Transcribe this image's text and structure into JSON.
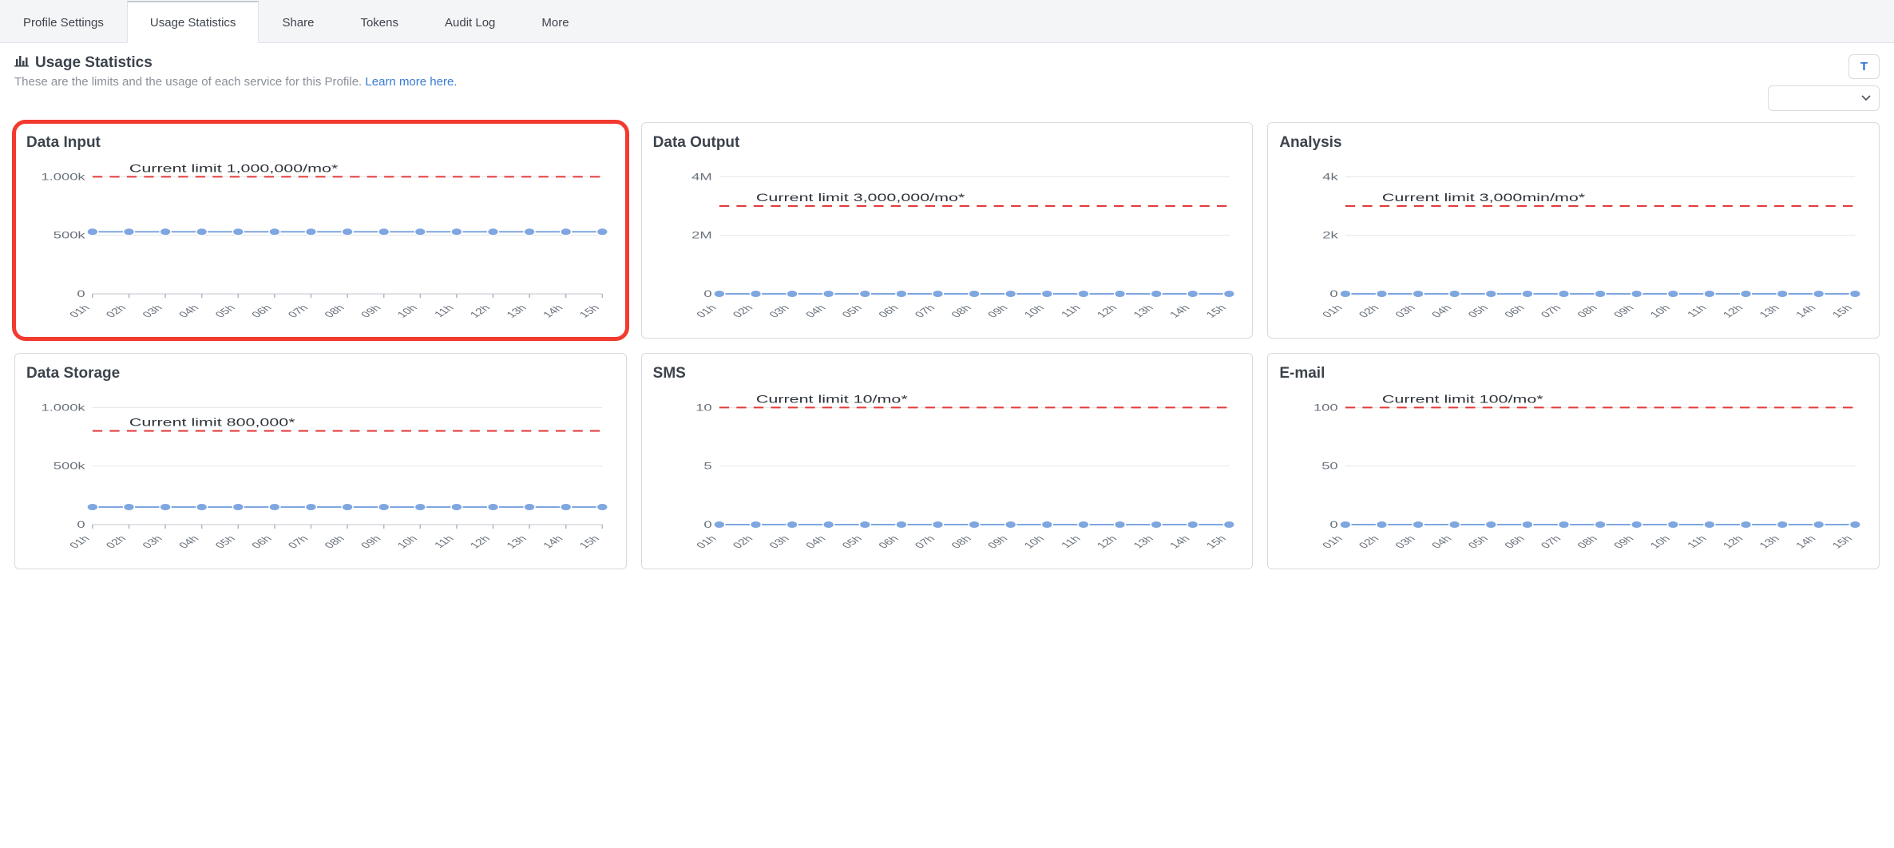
{
  "tabs": [
    {
      "label": "Profile Settings",
      "active": false
    },
    {
      "label": "Usage Statistics",
      "active": true
    },
    {
      "label": "Share",
      "active": false
    },
    {
      "label": "Tokens",
      "active": false
    },
    {
      "label": "Audit Log",
      "active": false
    },
    {
      "label": "More",
      "active": false
    }
  ],
  "header": {
    "title": "Usage Statistics",
    "subtitle": "These are the limits and the usage of each service for this Profile.",
    "learn_more": "Learn more here.",
    "badge_letter": "T"
  },
  "chart_data": [
    {
      "key": "data_input",
      "title": "Data Input",
      "type": "line",
      "highlighted": true,
      "categories": [
        "01h",
        "02h",
        "03h",
        "04h",
        "05h",
        "06h",
        "07h",
        "08h",
        "09h",
        "10h",
        "11h",
        "12h",
        "13h",
        "14h",
        "15h"
      ],
      "values": [
        530000,
        530000,
        530000,
        530000,
        530000,
        530000,
        530000,
        530000,
        530000,
        530000,
        530000,
        530000,
        530000,
        530000,
        530000
      ],
      "y_ticks": [
        0,
        500000,
        1000000
      ],
      "y_tick_labels": [
        "0",
        "500k",
        "1.000k"
      ],
      "limit_value": 1000000,
      "limit_label": "Current limit 1,000,000/mo*",
      "ylim": [
        0,
        1050000
      ]
    },
    {
      "key": "data_output",
      "title": "Data Output",
      "type": "line",
      "highlighted": false,
      "categories": [
        "01h",
        "02h",
        "03h",
        "04h",
        "05h",
        "06h",
        "07h",
        "08h",
        "09h",
        "10h",
        "11h",
        "12h",
        "13h",
        "14h",
        "15h"
      ],
      "values": [
        0,
        0,
        0,
        0,
        0,
        0,
        0,
        0,
        0,
        0,
        0,
        0,
        0,
        0,
        0
      ],
      "y_ticks": [
        0,
        2000000,
        4000000
      ],
      "y_tick_labels": [
        "0",
        "2M",
        "4M"
      ],
      "limit_value": 3000000,
      "limit_label": "Current limit 3,000,000/mo*",
      "ylim": [
        0,
        4200000
      ]
    },
    {
      "key": "analysis",
      "title": "Analysis",
      "type": "line",
      "highlighted": false,
      "categories": [
        "01h",
        "02h",
        "03h",
        "04h",
        "05h",
        "06h",
        "07h",
        "08h",
        "09h",
        "10h",
        "11h",
        "12h",
        "13h",
        "14h",
        "15h"
      ],
      "values": [
        0,
        0,
        0,
        0,
        0,
        0,
        0,
        0,
        0,
        0,
        0,
        0,
        0,
        0,
        0
      ],
      "y_ticks": [
        0,
        2000,
        4000
      ],
      "y_tick_labels": [
        "0",
        "2k",
        "4k"
      ],
      "limit_value": 3000,
      "limit_label": "Current limit 3,000min/mo*",
      "ylim": [
        0,
        4200
      ]
    },
    {
      "key": "data_storage",
      "title": "Data Storage",
      "type": "line",
      "highlighted": false,
      "categories": [
        "01h",
        "02h",
        "03h",
        "04h",
        "05h",
        "06h",
        "07h",
        "08h",
        "09h",
        "10h",
        "11h",
        "12h",
        "13h",
        "14h",
        "15h"
      ],
      "values": [
        150000,
        150000,
        150000,
        150000,
        150000,
        150000,
        150000,
        150000,
        150000,
        150000,
        150000,
        150000,
        150000,
        150000,
        150000
      ],
      "y_ticks": [
        0,
        500000,
        1000000
      ],
      "y_tick_labels": [
        "0",
        "500k",
        "1.000k"
      ],
      "limit_value": 800000,
      "limit_label": "Current limit 800,000*",
      "ylim": [
        0,
        1050000
      ]
    },
    {
      "key": "sms",
      "title": "SMS",
      "type": "line",
      "highlighted": false,
      "categories": [
        "01h",
        "02h",
        "03h",
        "04h",
        "05h",
        "06h",
        "07h",
        "08h",
        "09h",
        "10h",
        "11h",
        "12h",
        "13h",
        "14h",
        "15h"
      ],
      "values": [
        0,
        0,
        0,
        0,
        0,
        0,
        0,
        0,
        0,
        0,
        0,
        0,
        0,
        0,
        0
      ],
      "y_ticks": [
        0,
        5,
        10
      ],
      "y_tick_labels": [
        "0",
        "5",
        "10"
      ],
      "limit_value": 10,
      "limit_label": "Current limit 10/mo*",
      "ylim": [
        0,
        10.5
      ]
    },
    {
      "key": "email",
      "title": "E-mail",
      "type": "line",
      "highlighted": false,
      "categories": [
        "01h",
        "02h",
        "03h",
        "04h",
        "05h",
        "06h",
        "07h",
        "08h",
        "09h",
        "10h",
        "11h",
        "12h",
        "13h",
        "14h",
        "15h"
      ],
      "values": [
        0,
        0,
        0,
        0,
        0,
        0,
        0,
        0,
        0,
        0,
        0,
        0,
        0,
        0,
        0
      ],
      "y_ticks": [
        0,
        50,
        100
      ],
      "y_tick_labels": [
        "0",
        "50",
        "100"
      ],
      "limit_value": 100,
      "limit_label": "Current limit 100/mo*",
      "ylim": [
        0,
        105
      ]
    }
  ]
}
